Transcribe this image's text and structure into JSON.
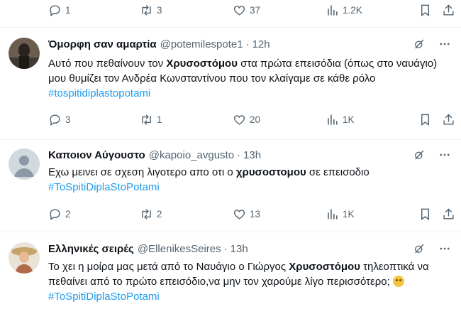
{
  "top_actions": {
    "replies": "1",
    "retweets": "3",
    "likes": "37",
    "views": "1.2K"
  },
  "tweets": [
    {
      "author_name": "Όμορφη σαν αμαρτία",
      "handle": "@potemilespote1",
      "separator": "·",
      "time": "12h",
      "text_1": "Αυτό που πεθαίνουν τον ",
      "bold_1": "Χρυσοστόμου",
      "text_2": " στα πρώτα επεισόδια (όπως στο ναυάγιο) μου θυμίζει τον  Ανδρέα Κωνσταντίνου  που τον κλαίγαμε σε κάθε ρόλο ",
      "hashtag": "#tospitidiplastopotami",
      "replies": "3",
      "retweets": "1",
      "likes": "20",
      "views": "1K"
    },
    {
      "author_name": "Καποιον Αύγουστο",
      "handle": "@kapoio_avgusto",
      "separator": "·",
      "time": "13h",
      "text_1": "Εχω μεινει σε σχεση λιγοτερο απο οτι ο ",
      "bold_1": "χρυσοστομου",
      "text_2": " σε επεισοδιο",
      "hashtag": "#ToSpitiDiplaStoPotami",
      "replies": "2",
      "retweets": "2",
      "likes": "13",
      "views": "1K"
    },
    {
      "author_name": "Ελληνικές σειρές",
      "handle": "@EllenikesSeires",
      "separator": "·",
      "time": "13h",
      "text_1": "Το χει η μοίρα μας μετά από το Ναυάγιο ο Γιώργος ",
      "bold_1": "Χρυσοστόμου",
      "text_2": " τηλεοπτικά να πεθαίνει από το πρώτο επεισόδιο,να μην τον χαρούμε λίγο περισσότερο; ",
      "hashtag": "#ToSpitiDiplaStoPotami"
    }
  ],
  "icons": {
    "reply": "reply-icon",
    "retweet": "retweet-icon",
    "like": "heart-icon",
    "views": "views-icon",
    "bookmark": "bookmark-icon",
    "share": "share-icon",
    "grok": "grok-icon",
    "more": "more-icon"
  },
  "colors": {
    "text": "#0f1419",
    "muted": "#536471",
    "hashtag": "#1d9bf0",
    "divider": "#eff3f4"
  }
}
